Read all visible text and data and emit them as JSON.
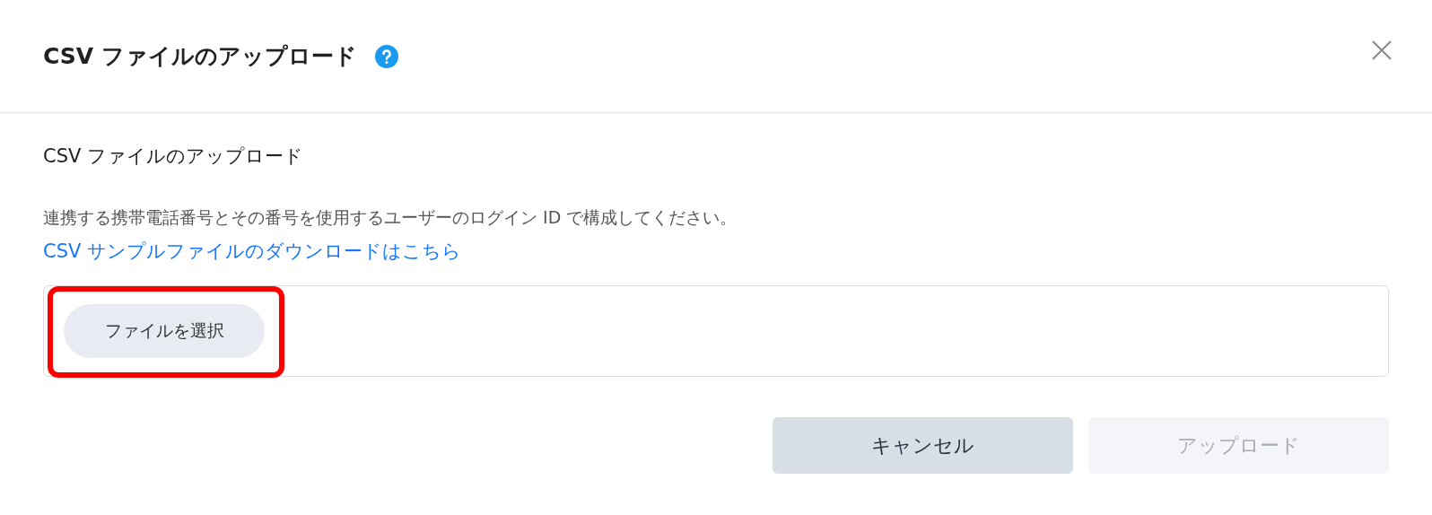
{
  "dialog": {
    "title": "CSV ファイルのアップロード",
    "help_icon": true
  },
  "section_title": "CSV ファイルのアップロード",
  "description": "連携する携帯電話番号とその番号を使用するユーザーのログイン ID で構成してください。",
  "sample_link": "CSV サンプルファイルのダウンロードはこちら",
  "file_picker": {
    "button": "ファイルを選択",
    "highlighted": true
  },
  "buttons": [
    {
      "label": "キャンセル",
      "disabled": false
    },
    {
      "label": "アップロード",
      "disabled": true
    }
  ]
}
